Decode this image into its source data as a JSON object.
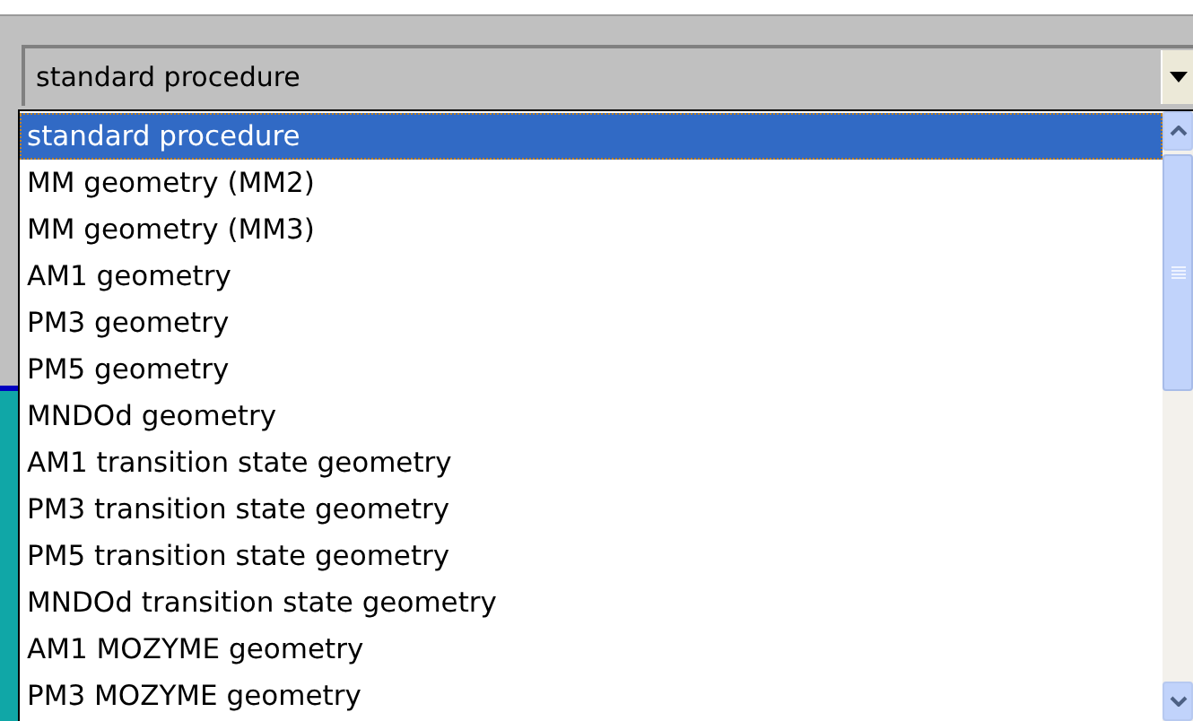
{
  "combo": {
    "value": "standard procedure"
  },
  "options": [
    {
      "label": "standard procedure",
      "selected": true
    },
    {
      "label": "MM geometry (MM2)",
      "selected": false
    },
    {
      "label": "MM geometry (MM3)",
      "selected": false
    },
    {
      "label": "AM1 geometry",
      "selected": false
    },
    {
      "label": "PM3 geometry",
      "selected": false
    },
    {
      "label": "PM5 geometry",
      "selected": false
    },
    {
      "label": "MNDOd geometry",
      "selected": false
    },
    {
      "label": "AM1 transition state geometry",
      "selected": false
    },
    {
      "label": "PM3 transition state geometry",
      "selected": false
    },
    {
      "label": "PM5 transition state geometry",
      "selected": false
    },
    {
      "label": "MNDOd transition state geometry",
      "selected": false
    },
    {
      "label": "AM1 MOZYME geometry",
      "selected": false
    },
    {
      "label": "PM3 MOZYME geometry",
      "selected": false
    }
  ]
}
